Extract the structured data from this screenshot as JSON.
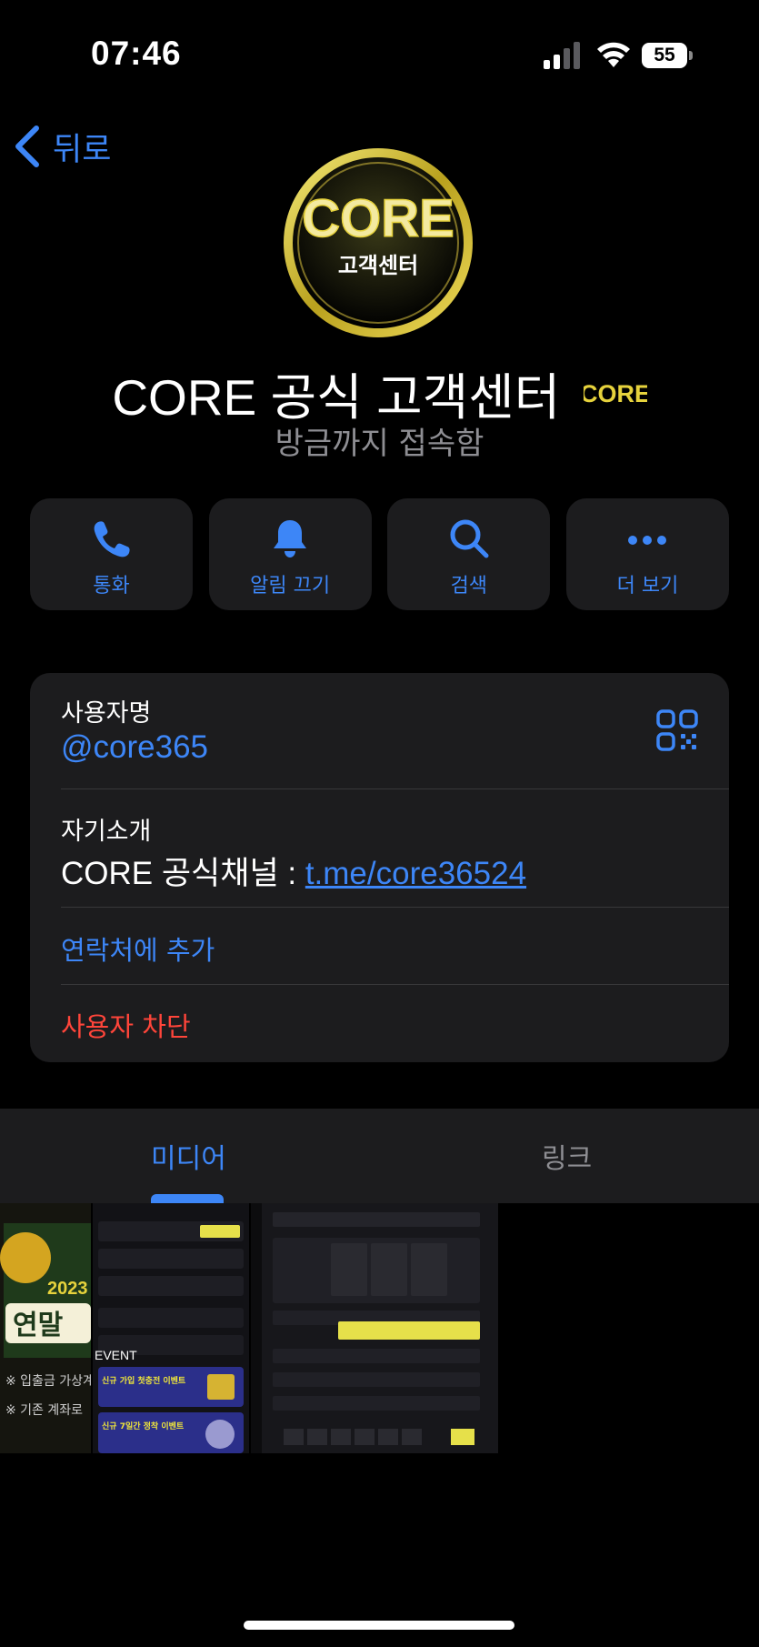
{
  "status_bar": {
    "time": "07:46",
    "battery": "55"
  },
  "nav": {
    "back_label": "뒤로"
  },
  "profile": {
    "avatar_text_main": "CORE",
    "avatar_text_sub": "고객센터",
    "name": "CORE 공식 고객센터",
    "badge_text": "CORE",
    "status": "방금까지 접속함"
  },
  "actions": [
    {
      "label": "통화",
      "icon": "phone-icon"
    },
    {
      "label": "알림 끄기",
      "icon": "bell-icon"
    },
    {
      "label": "검색",
      "icon": "search-icon"
    },
    {
      "label": "더 보기",
      "icon": "more-icon"
    }
  ],
  "info": {
    "username_label": "사용자명",
    "username_value": "@core365",
    "bio_label": "자기소개",
    "bio_prefix": "CORE 공식채널 : ",
    "bio_link": "t.me/core36524",
    "add_contact": "연락처에 추가",
    "block_user": "사용자 차단"
  },
  "tabs": {
    "media": "미디어",
    "links": "링크"
  },
  "media_thumbs": {
    "thumb1": {
      "year": "2023",
      "banner": "연말",
      "note1": "※ 입출금 가상계",
      "note2": "※ 기존 계좌로"
    },
    "thumb2": {
      "event_title": "EVENT",
      "promo1": "신규 가입 첫충전 이벤트",
      "promo2": "신규 7일간 정착 이벤트"
    }
  },
  "colors": {
    "accent": "#3d86f7",
    "destructive": "#ff453a",
    "card_bg": "#1c1c1e",
    "secondary_text": "#8e8e93",
    "brand_gold": "#e6d23c"
  }
}
